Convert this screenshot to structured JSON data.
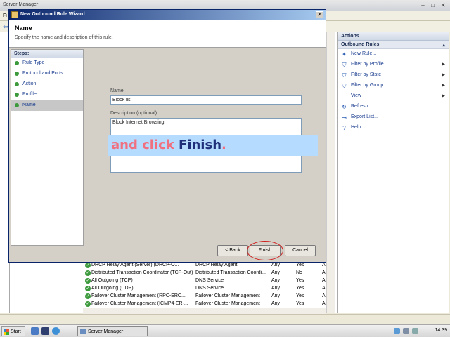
{
  "server_manager": {
    "title": "Server Manager",
    "menu_first_letter": "Fi"
  },
  "actions": {
    "title": "Actions",
    "section": "Outbound Rules",
    "items": [
      {
        "label": "New Rule...",
        "icon": "new-rule-icon",
        "has_submenu": false
      },
      {
        "label": "Filter by Profile",
        "icon": "filter-icon",
        "has_submenu": true
      },
      {
        "label": "Filter by State",
        "icon": "filter-icon",
        "has_submenu": true
      },
      {
        "label": "Filter by Group",
        "icon": "filter-icon",
        "has_submenu": true
      },
      {
        "label": "View",
        "icon": "",
        "has_submenu": true
      },
      {
        "label": "Refresh",
        "icon": "refresh-icon",
        "has_submenu": false
      },
      {
        "label": "Export List...",
        "icon": "export-icon",
        "has_submenu": false
      },
      {
        "label": "Help",
        "icon": "help-icon",
        "has_submenu": false
      }
    ]
  },
  "rules": [
    {
      "name": "DHCP Relay Agent (Server) (DHCP-O...",
      "group": "DHCP Relay Agent",
      "profile": "Any",
      "enabled": "Yes",
      "action": "A"
    },
    {
      "name": "Distributed Transaction Coordinator (TCP-Out)",
      "group": "Distributed Transaction Coordi...",
      "profile": "Any",
      "enabled": "No",
      "action": "A"
    },
    {
      "name": "All Outgoing (TCP)",
      "group": "DNS Service",
      "profile": "Any",
      "enabled": "Yes",
      "action": "A"
    },
    {
      "name": "All Outgoing (UDP)",
      "group": "DNS Service",
      "profile": "Any",
      "enabled": "Yes",
      "action": "A"
    },
    {
      "name": "Failover Cluster Management (RPC-ERC...",
      "group": "Failover Cluster Management",
      "profile": "Any",
      "enabled": "Yes",
      "action": "A"
    },
    {
      "name": "Failover Cluster Management (ICMP4-ER-...",
      "group": "Failover Cluster Management",
      "profile": "Any",
      "enabled": "Yes",
      "action": "A"
    }
  ],
  "wizard": {
    "title": "New Outbound Rule Wizard",
    "heading": "Name",
    "subheading": "Specify the name and description of this rule.",
    "steps_title": "Steps:",
    "steps": [
      {
        "label": "Rule Type",
        "current": false
      },
      {
        "label": "Protocol and Ports",
        "current": false
      },
      {
        "label": "Action",
        "current": false
      },
      {
        "label": "Profile",
        "current": false
      },
      {
        "label": "Name",
        "current": true
      }
    ],
    "name_label": "Name:",
    "name_value": "Block iis",
    "description_label": "Description (optional):",
    "description_value": "Block Internet Browsing",
    "back_label": "< Back",
    "finish_label": "Finish",
    "cancel_label": "Cancel"
  },
  "callout": {
    "part1": "and click ",
    "part2": "Finish",
    "part3": "."
  },
  "taskbar": {
    "start_label": "Start",
    "task_label": "Server Manager",
    "clock": "14:39"
  },
  "colors": {
    "callout_bg": "#b5dcff",
    "callout_pink": "#f07080",
    "callout_navy": "#1f2f7a",
    "highlight_ring": "#d01c1c"
  }
}
